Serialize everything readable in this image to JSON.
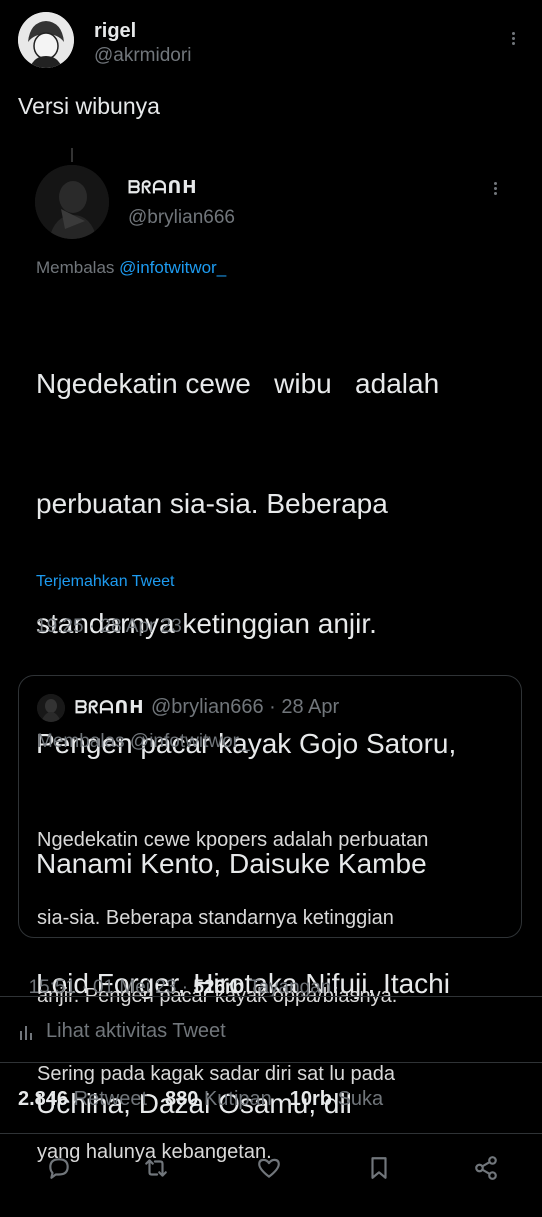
{
  "outer": {
    "display_name": "rigel",
    "handle": "@akrmidori",
    "text": "Versi wibunya",
    "more_icon": "more-dots-icon"
  },
  "inner": {
    "display_name": "ᗷᖇᗩᑎᕼ",
    "handle": "@brylian666",
    "reply_prefix": "Membalas",
    "reply_to": "@infotwitwor_",
    "lines": [
      "Ngedekatin cewe   wibu   adalah",
      "perbuatan sia-sia. Beberapa",
      "standarnya ketinggian anjir.",
      "Pengen pacar kayak Gojo Satoru,",
      "Nanami Kento, Daisuke Kambe",
      "Loid Forger, Hirotaka Nifuji, Itachi",
      "Uchiha, Dazai Osamu, dll"
    ],
    "translate": "Terjemahkan Tweet",
    "timestamp": "19:25 · 28 Apr 23"
  },
  "quoted": {
    "display_name": "ᗷᖇᗩᑎᕼ",
    "handle_date": "@brylian666 · 28 Apr",
    "reply_line": "Membalas @infotwitwor_",
    "lines": [
      "Ngedekatin cewe kpopers adalah perbuatan",
      "sia-sia. Beberapa standarnya ketinggian",
      "anjir. Pengen pacar kayak oppa/biasnya.",
      "Sering pada kagak sadar diri sat lu pada",
      "yang halunya kebangetan."
    ]
  },
  "meta": {
    "time_date": "15:51 · 01 Mei 23 · ",
    "views_count": "526rb",
    "views_label": " Tayangan",
    "activity": "Lihat aktivitas Tweet"
  },
  "stats": [
    {
      "count": "2.846",
      "label": "Retweet"
    },
    {
      "count": "880",
      "label": "Kutipan"
    },
    {
      "count": "10rb",
      "label": "Suka"
    }
  ],
  "actions": {
    "reply_icon": "reply-icon",
    "retweet_icon": "retweet-icon",
    "like_icon": "heart-icon",
    "bookmark_icon": "bookmark-icon",
    "share_icon": "share-icon"
  }
}
